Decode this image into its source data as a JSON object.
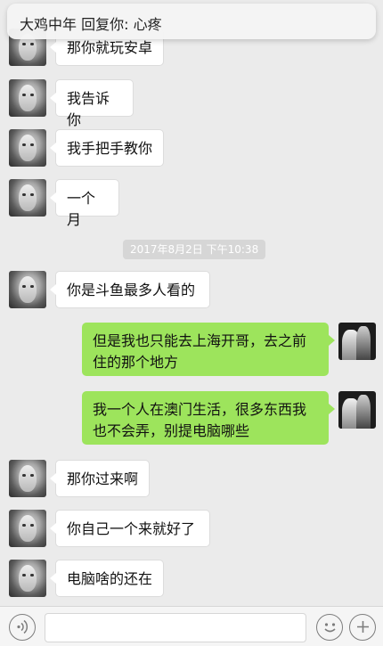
{
  "notification": {
    "text": "大鸡中年 回复你: 心疼"
  },
  "timestamp": "2017年8月2日 下午10:38",
  "messages": [
    {
      "side": "left",
      "text": "那你就玩安卓"
    },
    {
      "side": "left",
      "text": "我告诉你"
    },
    {
      "side": "left",
      "text": "我手把手教你"
    },
    {
      "side": "left",
      "text": "一个月"
    },
    {
      "side": "left",
      "text": "你是斗鱼最多人看的"
    },
    {
      "side": "right",
      "text": "但是我也只能去上海开哥，去之前住的那个地方"
    },
    {
      "side": "right",
      "text": "我一个人在澳门生活，很多东西我也不会弄，别提电脑哪些"
    },
    {
      "side": "left",
      "text": "那你过来啊"
    },
    {
      "side": "left",
      "text": "你自己一个来就好了"
    },
    {
      "side": "left",
      "text": "电脑啥的还在"
    }
  ],
  "input_bar": {
    "voice_icon": "voice-icon",
    "emoji_icon": "emoji-icon",
    "add_icon": "plus-icon",
    "input_value": ""
  }
}
